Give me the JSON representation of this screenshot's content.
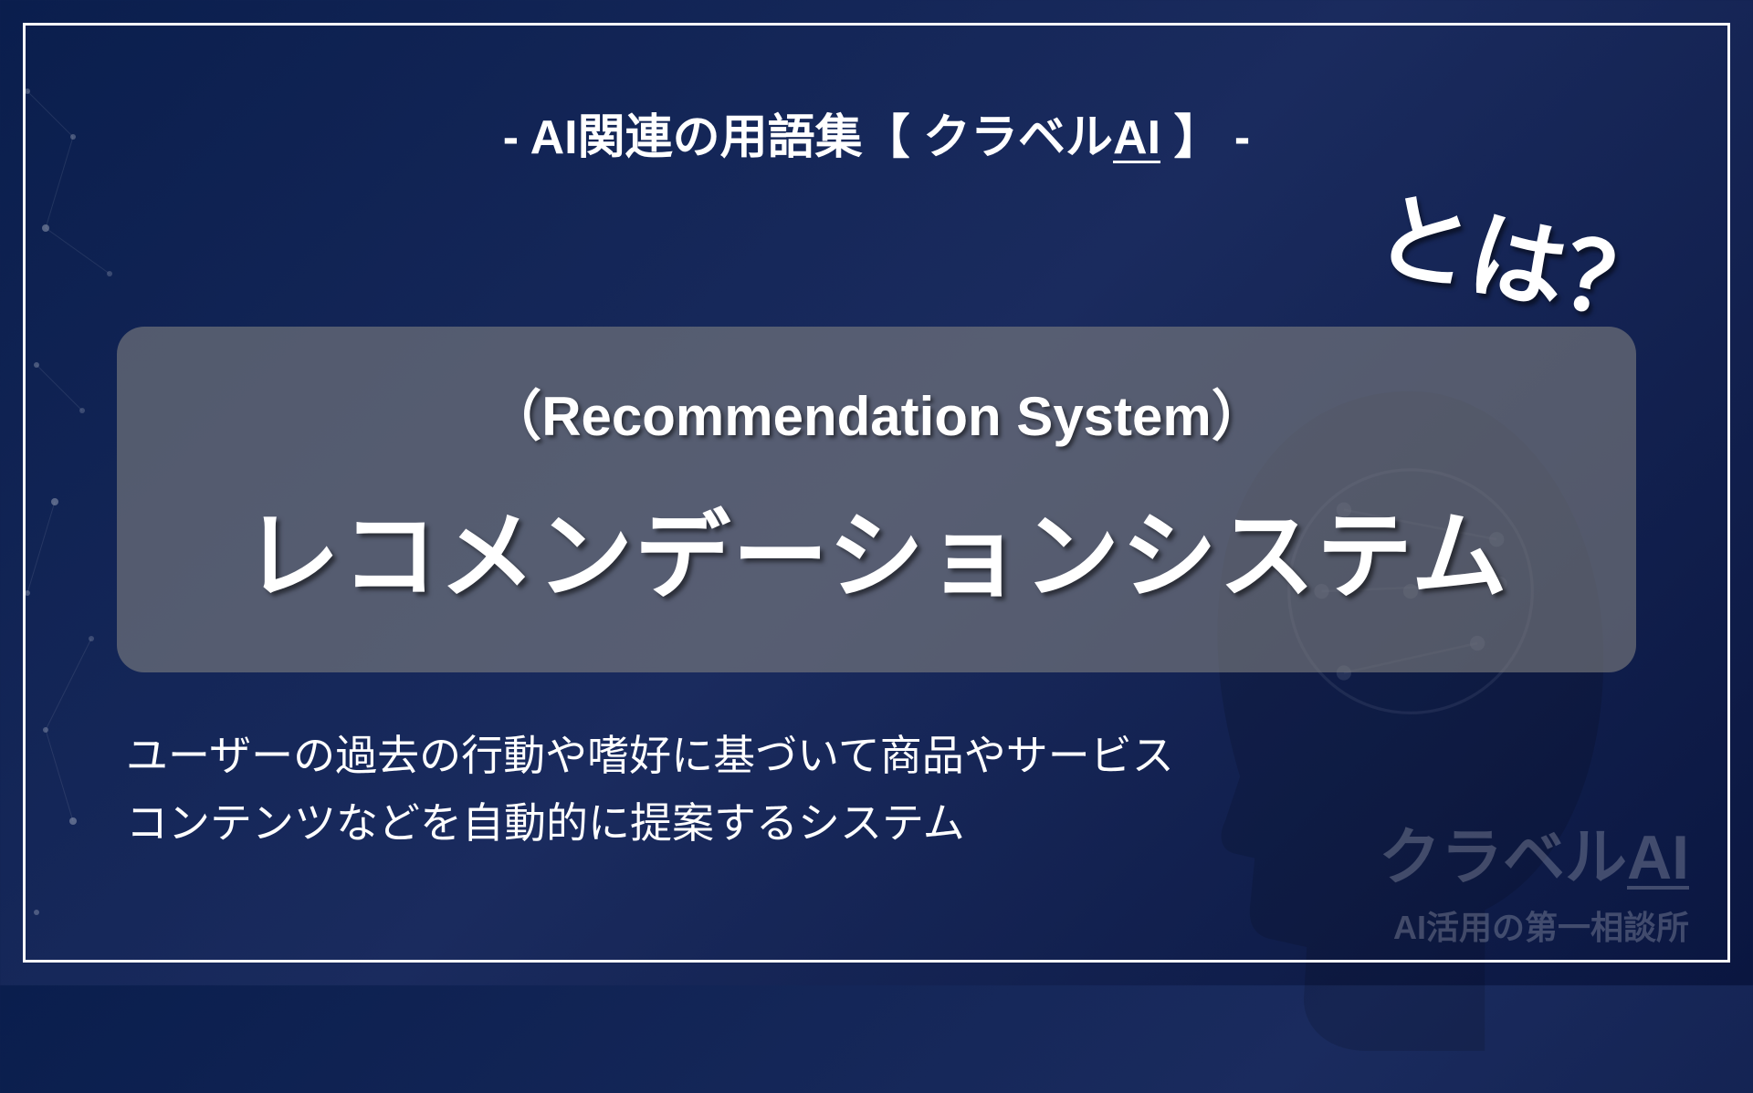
{
  "header": {
    "prefix": "- AI関連の用語集【 クラベル",
    "underlined": "AI",
    "suffix": " 】 -"
  },
  "main": {
    "english_title": "（Recommendation System）",
    "japanese_title": "レコメンデーションシステム",
    "callout": "とは？"
  },
  "description": {
    "line1": "ユーザーの過去の行動や嗜好に基づいて商品やサービス",
    "line2": "コンテンツなどを自動的に提案するシステム"
  },
  "footer": {
    "logo_prefix": "クラベル",
    "logo_underlined": "AI",
    "tagline": "AI活用の第一相談所"
  }
}
